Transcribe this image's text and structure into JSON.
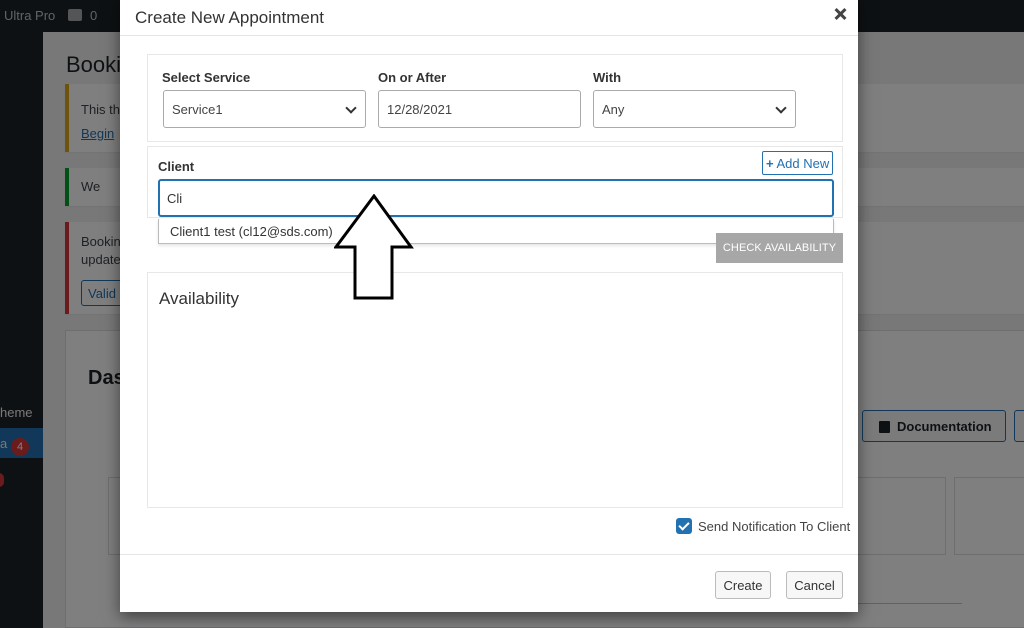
{
  "admin": {
    "brand": "Ultra Pro",
    "comment_count": "0",
    "menu_theme": "heme",
    "menu_active": "a",
    "menu_badge": "4",
    "page_title": "Booki",
    "notice1": "This th",
    "notice1_link": "Begin",
    "notice2": "We",
    "notice3_line1": "Bookin",
    "notice3_line2": "update",
    "notice3_button": "Valid",
    "dashboard_title": "Das",
    "documentation_button": "Documentation"
  },
  "modal": {
    "title": "Create New Appointment",
    "fields": {
      "service_label": "Select Service",
      "service_value": "Service1",
      "date_label": "On or After",
      "date_value": "12/28/2021",
      "with_label": "With",
      "with_value": "Any"
    },
    "client": {
      "label": "Client",
      "add_new": "Add New",
      "input_value": "Cli",
      "suggestion": "Client1 test (cl12@sds.com)"
    },
    "check_availability": "CHECK AVAILABILITY",
    "availability_title": "Availability",
    "notify_label": "Send Notification To Client",
    "notify_checked": true,
    "create_button": "Create",
    "cancel_button": "Cancel"
  },
  "colors": {
    "accent": "#2271b1",
    "check_button": "#a7a7a7"
  },
  "icons": {
    "close": "close-icon",
    "dropdown": "chevron-down-icon",
    "add": "plus-icon",
    "checkbox": "check-icon",
    "annotation": "up-arrow-icon"
  }
}
